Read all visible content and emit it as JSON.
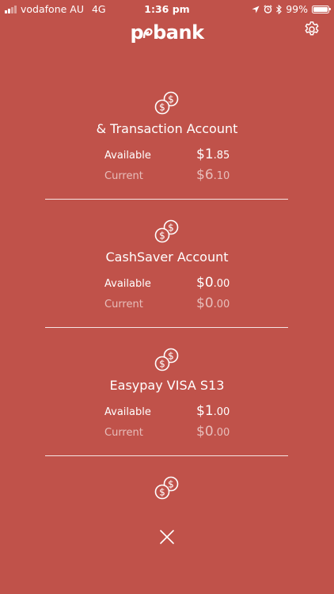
{
  "status_bar": {
    "carrier": "vodafone AU",
    "network": "4G",
    "time": "1:36 pm",
    "battery": "99%",
    "battery_level": 0.99
  },
  "header": {
    "logo_prefix": "p",
    "logo_text": "bank"
  },
  "accounts": [
    {
      "name": "& Transaction Account",
      "available_label": "Available",
      "available_dollars": "$1",
      "available_cents": ".85",
      "current_label": "Current",
      "current_dollars": "$6",
      "current_cents": ".10"
    },
    {
      "name": "CashSaver Account",
      "available_label": "Available",
      "available_dollars": "$0",
      "available_cents": ".00",
      "current_label": "Current",
      "current_dollars": "$0",
      "current_cents": ".00"
    },
    {
      "name": "Easypay VISA S13",
      "available_label": "Available",
      "available_dollars": "$1",
      "available_cents": ".00",
      "current_label": "Current",
      "current_dollars": "$0",
      "current_cents": ".00"
    }
  ],
  "icons": {
    "settings": "gear-icon",
    "coins": "coins-icon",
    "close": "close-icon"
  },
  "colors": {
    "background": "#c0524a",
    "text": "#ffffff"
  }
}
